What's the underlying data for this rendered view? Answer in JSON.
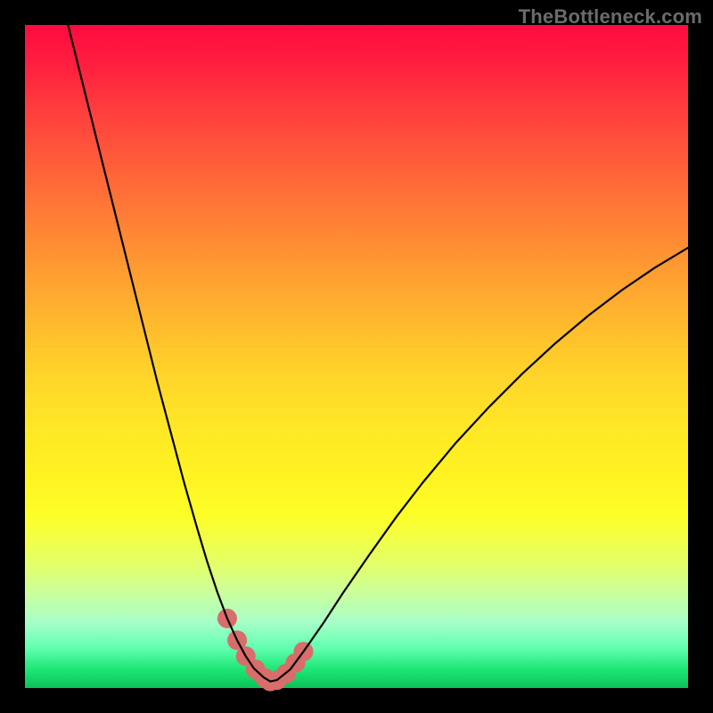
{
  "watermark": "TheBottleneck.com",
  "colors": {
    "curve": "#000000",
    "marker_fill": "#d86d6a",
    "marker_stroke": "#b94f4d",
    "frame_bg": "#000000"
  },
  "chart_data": {
    "type": "line",
    "title": "",
    "xlabel": "",
    "ylabel": "",
    "xlim": [
      0,
      100
    ],
    "ylim": [
      0,
      100
    ],
    "grid": false,
    "legend": false,
    "series": [
      {
        "name": "bottleneck-curve",
        "x_pct": [
          6.5,
          8,
          10,
          12,
          14,
          16,
          18,
          20,
          22,
          24,
          26,
          27.5,
          29,
          30.5,
          32,
          33.3,
          34.5,
          36,
          37,
          38,
          40,
          42,
          45,
          48,
          52,
          56,
          60,
          65,
          70,
          75,
          80,
          85,
          90,
          95,
          100
        ],
        "y_pct": [
          100,
          94,
          86,
          78,
          70,
          62,
          54,
          46,
          38.5,
          31,
          24,
          19,
          14.5,
          10.5,
          7.2,
          4.8,
          3.0,
          1.6,
          1.0,
          1.2,
          2.8,
          5.5,
          9.8,
          14.4,
          20.2,
          25.8,
          31.0,
          37.0,
          42.4,
          47.4,
          52.0,
          56.2,
          60.0,
          63.4,
          66.4
        ]
      }
    ],
    "markers": {
      "name": "highlight-region",
      "x_pct": [
        30.5,
        32.0,
        33.3,
        34.8,
        36.2,
        37.0,
        38.0,
        39.4,
        40.8,
        42.0
      ],
      "y_pct": [
        10.5,
        7.2,
        4.8,
        2.8,
        1.5,
        1.0,
        1.2,
        2.2,
        3.8,
        5.5
      ],
      "radius_px": 11
    }
  }
}
